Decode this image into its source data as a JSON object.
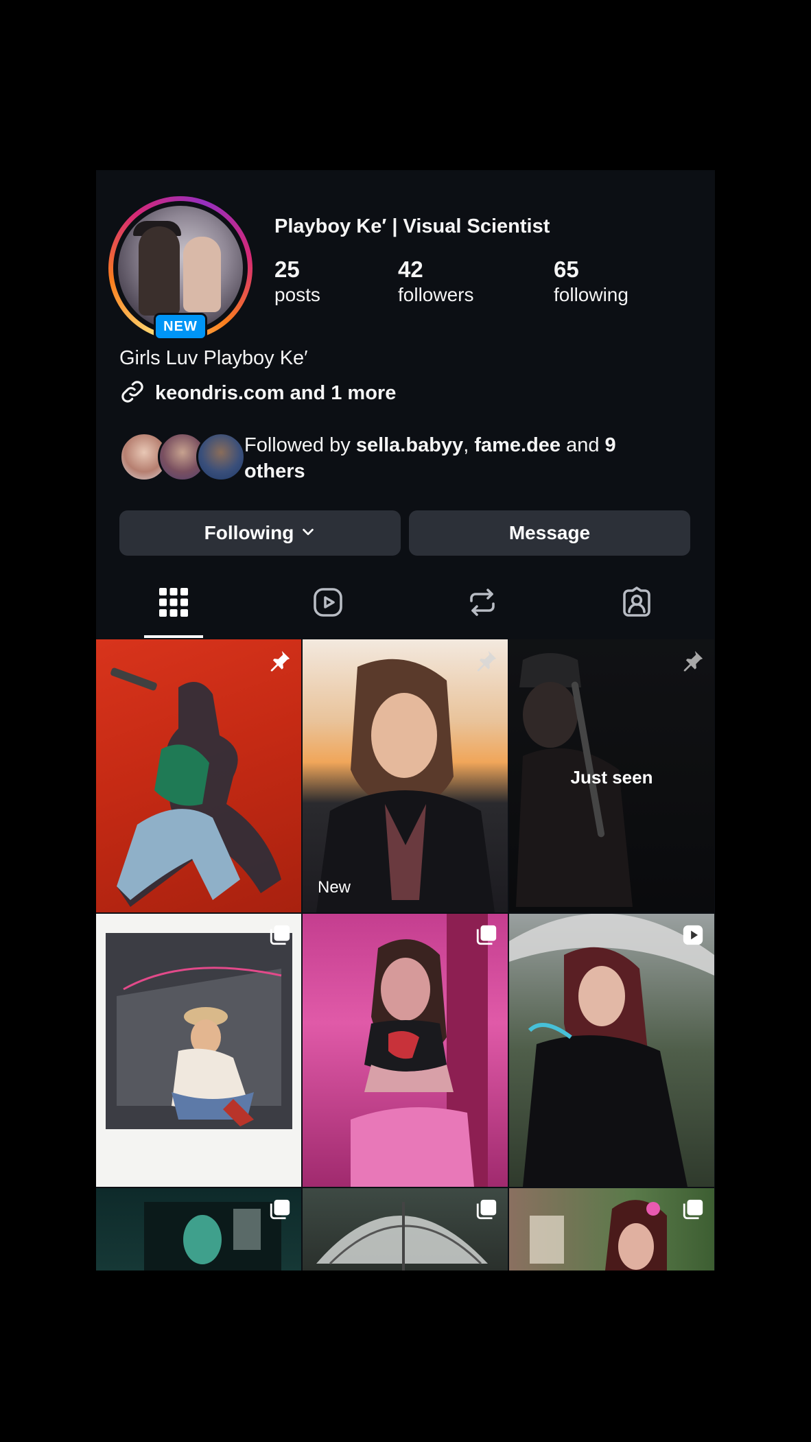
{
  "profile": {
    "name": "Playboy Ke′ | Visual Scientist",
    "avatar_badge": "NEW",
    "stats": [
      {
        "value": "25",
        "label": "posts"
      },
      {
        "value": "42",
        "label": "followers"
      },
      {
        "value": "65",
        "label": "following"
      }
    ],
    "bio": "Girls Luv Playboy Ke′",
    "link": "keondris.com and 1 more",
    "followed_by": {
      "prefix": "Followed by ",
      "user1": "sella.babyy",
      "sep": ", ",
      "user2": "fame.dee",
      "and": " and ",
      "others": "9 others"
    }
  },
  "actions": {
    "following_label": "Following",
    "message_label": "Message"
  },
  "tabs": [
    {
      "icon": "grid-icon",
      "active": true
    },
    {
      "icon": "reels-icon",
      "active": false
    },
    {
      "icon": "reposts-icon",
      "active": false
    },
    {
      "icon": "tagged-icon",
      "active": false
    }
  ],
  "grid": {
    "posts": [
      {
        "icon": "pin-icon",
        "overlay": ""
      },
      {
        "icon": "pin-icon",
        "overlay": "New"
      },
      {
        "icon": "pin-icon",
        "overlay": "Just seen"
      },
      {
        "icon": "carousel-icon",
        "overlay": ""
      },
      {
        "icon": "carousel-icon",
        "overlay": ""
      },
      {
        "icon": "reel-icon",
        "overlay": ""
      },
      {
        "icon": "carousel-icon",
        "overlay": ""
      },
      {
        "icon": "carousel-icon",
        "overlay": ""
      },
      {
        "icon": "carousel-icon",
        "overlay": ""
      }
    ]
  },
  "colors": {
    "background": "#0c0f14",
    "button": "#2c3038",
    "badge": "#0095f6"
  }
}
